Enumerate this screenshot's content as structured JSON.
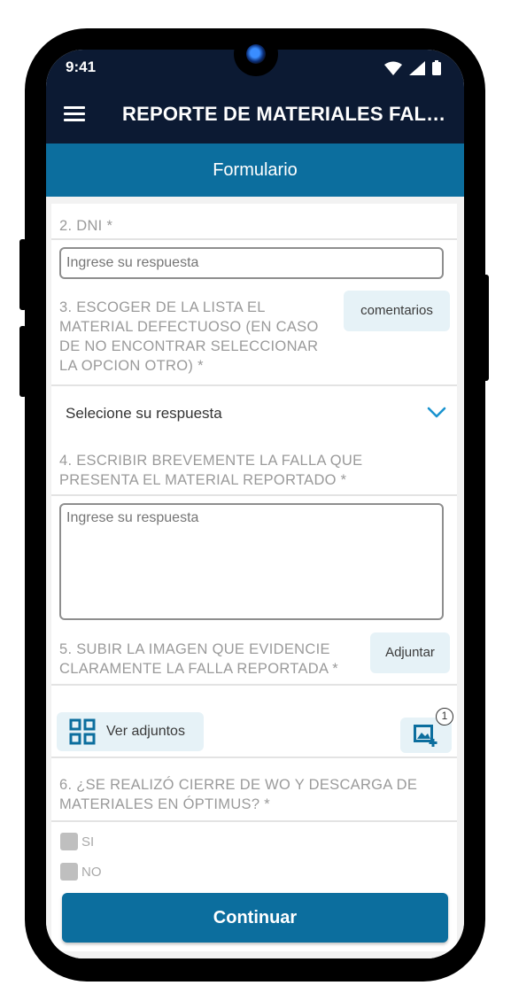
{
  "status_bar": {
    "time": "9:41"
  },
  "app_bar": {
    "title": "REPORTE DE MATERIALES FALLI..."
  },
  "tab": {
    "label": "Formulario"
  },
  "questions": {
    "q2": {
      "label": "2. DNI  *",
      "placeholder": "Ingrese su respuesta"
    },
    "q3": {
      "label_lines": [
        "3. ESCOGER DE LA LISTA EL",
        "MATERIAL DEFECTUOSO (EN CASO",
        "DE NO ENCONTRAR SELECCIONAR",
        "LA OPCION OTRO) *"
      ],
      "comments_label": "comentarios",
      "select_value": "Selecione su respuesta"
    },
    "q4": {
      "label_lines": [
        "4. ESCRIBIR BREVEMENTE LA FALLA QUE",
        "PRESENTA EL MATERIAL REPORTADO *"
      ],
      "placeholder": "Ingrese su respuesta"
    },
    "q5": {
      "label_lines": [
        "5. SUBIR LA IMAGEN QUE EVIDENCIE",
        "CLARAMENTE LA FALLA REPORTADA *"
      ],
      "attach_label": "Adjuntar",
      "view_attachments_label": "Ver adjuntos",
      "attachment_count": "1"
    },
    "q6": {
      "label_lines": [
        "6. ¿SE REALIZÓ CIERRE DE WO Y DESCARGA DE",
        "MATERIALES EN ÓPTIMUS? *"
      ],
      "options": [
        "SI",
        "NO"
      ]
    }
  },
  "continue_label": "Continuar",
  "colors": {
    "app_bar": "#0c1a33",
    "accent": "#0c6e9e",
    "button_bg": "#e6f2f7",
    "label_gray": "#9a9a9a"
  }
}
